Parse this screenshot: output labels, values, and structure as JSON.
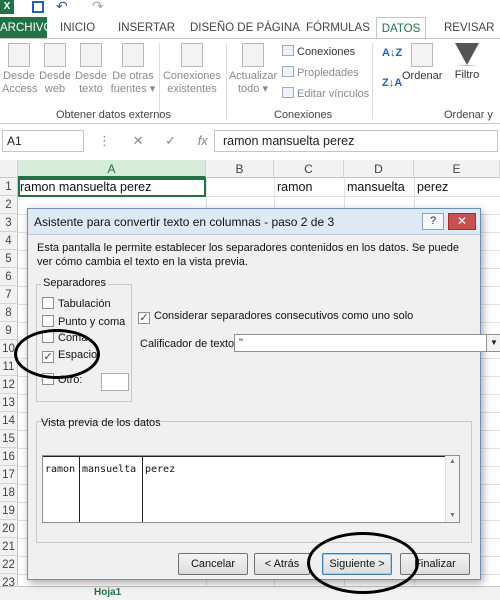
{
  "ribbon": {
    "file_tab": "ARCHIVO",
    "tabs": [
      "INICIO",
      "INSERTAR",
      "DISEÑO DE PÁGINA",
      "FÓRMULAS",
      "DATOS",
      "REVISAR"
    ],
    "active_tab": "DATOS",
    "external_data": {
      "buttons": [
        "Desde Access",
        "Desde web",
        "Desde texto",
        "De otras fuentes ▾"
      ],
      "existing": "Conexiones existentes",
      "group_label": "Obtener datos externos"
    },
    "connections": {
      "refresh": "Actualizar todo ▾",
      "items": [
        "Conexiones",
        "Propiedades",
        "Editar vínculos"
      ],
      "group_label": "Conexiones"
    },
    "sort_filter": {
      "sort": "Ordenar",
      "filter": "Filtro",
      "group_label": "Ordenar y"
    }
  },
  "formula_bar": {
    "name_box": "A1",
    "fx": "fx",
    "content": "ramon mansuelta perez"
  },
  "sheet": {
    "columns": [
      "A",
      "B",
      "C",
      "D",
      "E"
    ],
    "rows": [
      "1",
      "2",
      "3",
      "4",
      "5",
      "6",
      "7",
      "8",
      "9",
      "10",
      "11",
      "12",
      "13",
      "14",
      "15",
      "16",
      "17",
      "18",
      "19",
      "20",
      "21",
      "22",
      "23"
    ],
    "row1": {
      "A": "ramon mansuelta perez",
      "C": "ramon",
      "D": "mansuelta",
      "E": "perez"
    },
    "sheet_tab": "Hoja1"
  },
  "dialog": {
    "title": "Asistente para convertir texto en columnas - paso 2 de 3",
    "help": "?",
    "close": "✕",
    "description": "Esta pantalla le permite establecer los separadores contenidos en los datos. Se puede ver cómo cambia el texto en la vista previa.",
    "separators_label": "Separadores",
    "separators": [
      {
        "label": "Tabulación",
        "checked": false
      },
      {
        "label": "Punto y coma",
        "checked": false
      },
      {
        "label": "Coma",
        "checked": false
      },
      {
        "label": "Espacio",
        "checked": true
      },
      {
        "label": "Otro:",
        "checked": false
      }
    ],
    "consecutive": {
      "label": "Considerar separadores consecutivos como uno solo",
      "checked": true
    },
    "qualifier_label": "Calificador de texto:",
    "qualifier_value": "\"",
    "preview_label": "Vista previa de los datos",
    "preview_columns": [
      "ramon",
      "mansuelta",
      "perez"
    ],
    "buttons": {
      "cancel": "Cancelar",
      "back": "< Atrás",
      "next": "Siguiente >",
      "finish": "Finalizar"
    }
  }
}
